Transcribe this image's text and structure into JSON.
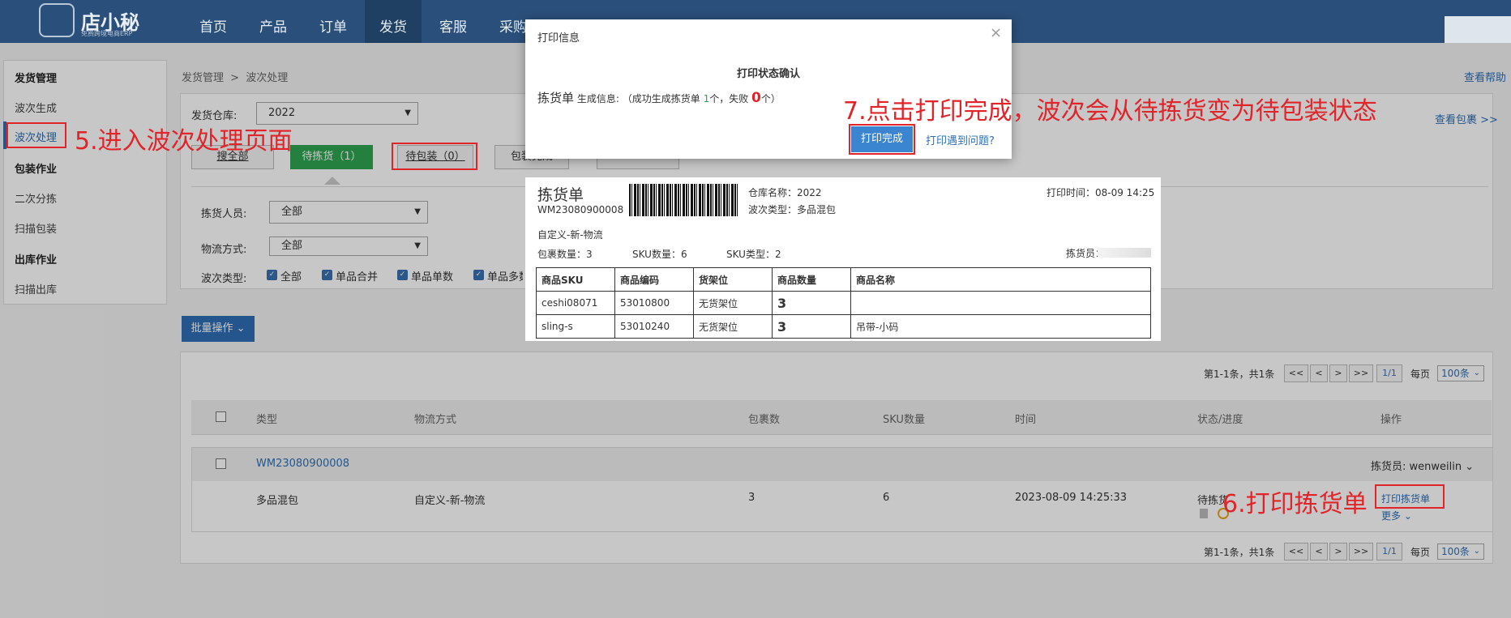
{
  "header": {
    "logo_text": "店小秘",
    "logo_sub": "免费跨境电商ERP",
    "nav": [
      "首页",
      "产品",
      "订单",
      "发货",
      "客服",
      "采购"
    ]
  },
  "sidebar": {
    "sections": [
      {
        "title": "发货管理",
        "items": [
          "波次生成",
          "波次处理"
        ]
      },
      {
        "title": "包装作业",
        "items": [
          "二次分拣",
          "扫描包装"
        ]
      },
      {
        "title": "出库作业",
        "items": [
          "扫描出库"
        ]
      }
    ]
  },
  "breadcrumb": {
    "parent": "发货管理",
    "sep": ">",
    "current": "波次处理"
  },
  "help_link": "查看帮助",
  "view_package_link": "查看包裹 >>",
  "filters": {
    "warehouse_label": "发货仓库:",
    "warehouse_value": "2022",
    "tabs": [
      "搜全部",
      "待拣货（1）",
      "待包装（0）",
      "包装完成"
    ],
    "picker_label": "拣货人员:",
    "picker_value": "全部",
    "logistics_label": "物流方式:",
    "logistics_value": "全部",
    "batch_type_label": "波次类型:",
    "batch_types": [
      "全部",
      "单品合并",
      "单品单数",
      "单品多数"
    ]
  },
  "batch_button": "批量操作",
  "pager": {
    "summary": "第1-1条，共1条",
    "first": "<<",
    "prev": "<",
    "next": ">",
    "last": ">>",
    "page": "1/1",
    "per_page_label": "每页",
    "per_page_value": "100条"
  },
  "table": {
    "headers": [
      "类型",
      "物流方式",
      "包裹数",
      "SKU数量",
      "时间",
      "状态/进度",
      "操作"
    ],
    "batch_id": "WM23080900008",
    "picker_label": "拣货员:",
    "picker_name": "wenweilin",
    "row": {
      "type": "多品混包",
      "logistics": "自定义-新-物流",
      "packages": "3",
      "sku_count": "6",
      "time": "2023-08-09 14:25:33",
      "status": "待拣货",
      "action_print": "打印拣货单",
      "action_more": "更多"
    }
  },
  "annotations": {
    "step5": "5.进入波次处理页面",
    "step6": "6.打印拣货单",
    "step7": "7.点击打印完成，波次会从待拣货变为待包装状态"
  },
  "modal": {
    "title": "打印信息",
    "close": "×",
    "heading": "打印状态确认",
    "label_doc": "拣货单",
    "label_info": "生成信息:",
    "msg_prefix": "（成功生成拣货单",
    "success_count": "1",
    "msg_mid": "个，失败",
    "fail_count": "0",
    "msg_suffix": "个）",
    "confirm_button": "打印完成",
    "problem_link": "打印遇到问题?"
  },
  "pick_list": {
    "title": "拣货单",
    "id": "WM23080900008",
    "warehouse": "仓库名称：2022",
    "batch_type": "波次类型：多品混包",
    "print_time": "打印时间：08-09 14:25",
    "logistics": "自定义-新-物流",
    "packages": "包裹数量：3",
    "sku_qty": "SKU数量：6",
    "sku_types": "SKU类型：2",
    "picker": "拣货员：",
    "headers": [
      "商品SKU",
      "商品编码",
      "货架位",
      "商品数量",
      "商品名称"
    ],
    "rows": [
      [
        "ceshi08071",
        "53010800",
        "无货架位",
        "3",
        ""
      ],
      [
        "sling-s",
        "53010240",
        "无货架位",
        "3",
        "吊带-小码"
      ]
    ]
  }
}
